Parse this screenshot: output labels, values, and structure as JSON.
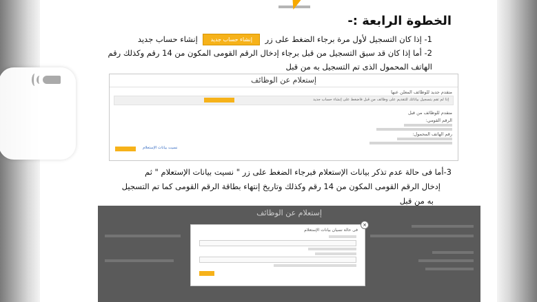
{
  "step_title": "الخطوة الرابعة :-",
  "line1": {
    "prefix": "1- إذا كان التسجيل لأول مرة برجاء الضغط على زر",
    "button": "إنشاء حساب جديد",
    "suffix": "إنشاء حساب جديد"
  },
  "line2": {
    "text_a": "2- أما إذا كان قد سبق التسجيل من قبل برجاء إدخال الرقم القومى المكون من 14 رقم وكذلك رقم",
    "text_b": "الهاتف المحمول الذى تم التسجيل به من قبل"
  },
  "panel1": {
    "title": "إستعلام عن الوظائف",
    "sub_head_1": "متقدم جديد للوظائف المعلن عنها",
    "row_text": "إذا لم تقم بتسجيل بياناتك للتقديم على وظائف من قبل فاضغط على إنشاء حساب جديد",
    "sub_head_2": "متقدم للوظائف من قبل",
    "national_id_label": "الرقم القومي:",
    "phone_label": "رقم الهاتف المحمول:",
    "forgot_link": "نسيت بيانات الإستعلام"
  },
  "line3": {
    "text_a": "3-أما فى حالة عدم تذكر بيانات الإستعلام فبرجاء الضغط على زر \" نسيت بيانات الإستعلام \" ثم",
    "text_b": "إدخال الرقم القومى المكون من 14 رقم وكذلك وتاريخ إنتهاء بطاقة الرقم القومى كما تم التسجيل",
    "text_c": "به من قبل"
  },
  "panel2": {
    "title": "إستعلام عن الوظائف",
    "modal_title": "فى حالة نسيان بيانات الإستعلام",
    "close_icon": "×"
  },
  "colors": {
    "accent": "#f6b21a",
    "dark_overlay": "#5a5a5a"
  }
}
